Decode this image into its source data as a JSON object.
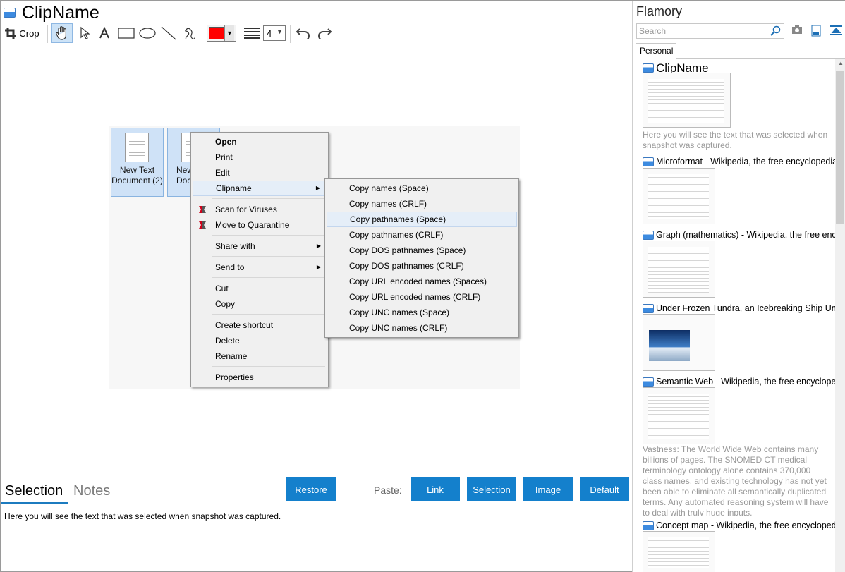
{
  "app": {
    "title": "ClipName"
  },
  "toolbar": {
    "crop_label": "Crop",
    "line_width": "4",
    "color": "#ff0000"
  },
  "files": [
    {
      "name": "New Text Document (2)"
    },
    {
      "name": "New Text Docu"
    }
  ],
  "context_menu": {
    "items": [
      "Open",
      "Print",
      "Edit",
      "Clipname",
      "Scan for Viruses",
      "Move to Quarantine",
      "Share with",
      "Send to",
      "Cut",
      "Copy",
      "Create shortcut",
      "Delete",
      "Rename",
      "Properties"
    ]
  },
  "submenu": {
    "items": [
      "Copy names (Space)",
      "Copy names (CRLF)",
      "Copy pathnames (Space)",
      "Copy pathnames (CRLF)",
      "Copy DOS pathnames (Space)",
      "Copy DOS pathnames (CRLF)",
      "Copy URL encoded names (Spaces)",
      "Copy URL encoded names (CRLF)",
      "Copy UNC names (Space)",
      "Copy UNC names (CRLF)"
    ]
  },
  "bottom": {
    "tab_selection": "Selection",
    "tab_notes": "Notes",
    "restore": "Restore",
    "paste_label": "Paste:",
    "paste_buttons": [
      "Link",
      "Selection",
      "Image",
      "Default"
    ],
    "selection_text": "Here you will see the text that was selected when snapshot was captured."
  },
  "sidebar": {
    "title": "Flamory",
    "search_placeholder": "Search",
    "tab": "Personal",
    "entries": [
      {
        "title": "ClipName",
        "note": "Here you will see the text that was selected when snapshot was captured."
      },
      {
        "title": "Microformat - Wikipedia, the free encyclopedia"
      },
      {
        "title": "Graph (mathematics) - Wikipedia, the free ency"
      },
      {
        "title": "Under Frozen Tundra, an Icebreaking Ship Unco"
      },
      {
        "title": "Semantic Web - Wikipedia, the free encycloped",
        "note": "Vastness: The World Wide Web contains many billions of pages. The SNOMED CT medical terminology ontology alone contains 370,000 class names, and existing technology has not yet been able to eliminate all semantically duplicated terms. Any automated reasoning system will have to deal with truly huge inputs."
      },
      {
        "title": "Concept map - Wikipedia, the free encyclopedi"
      }
    ]
  }
}
